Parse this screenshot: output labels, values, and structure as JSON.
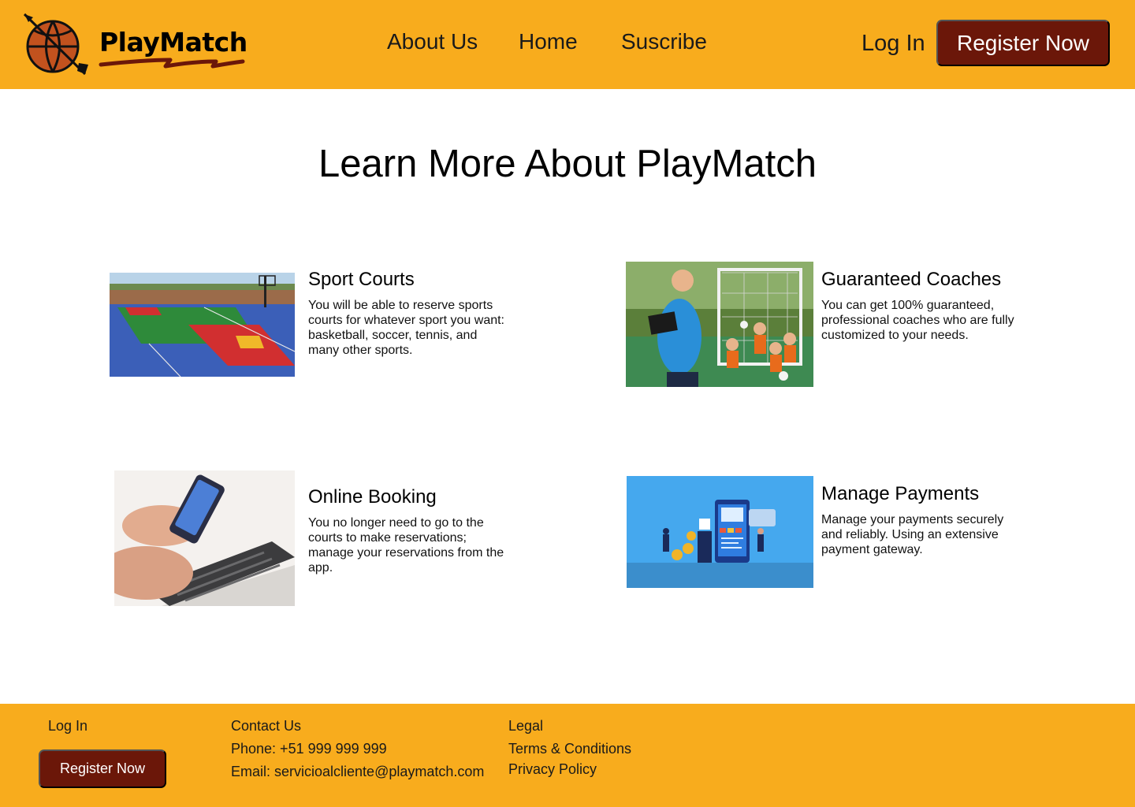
{
  "brand": {
    "name": "PlayMatch"
  },
  "nav": {
    "about": "About Us",
    "home": "Home",
    "subscribe": "Suscribe"
  },
  "header": {
    "login": "Log In",
    "register": "Register Now"
  },
  "main": {
    "title": "Learn More About PlayMatch",
    "features": [
      {
        "title": "Sport Courts",
        "description": "You will be able to reserve sports courts for whatever sport you want: basketball, soccer, tennis, and many other sports."
      },
      {
        "title": "Guaranteed Coaches",
        "description": "You can get 100% guaranteed, professional coaches who are fully customized to your needs."
      },
      {
        "title": "Online Booking",
        "description": "You no longer need to go to the courts to make reservations; manage your reservations from the app."
      },
      {
        "title": "Manage Payments",
        "description": "Manage your payments securely and reliably. Using an extensive payment gateway."
      }
    ]
  },
  "footer": {
    "login": "Log In",
    "register": "Register Now",
    "contact_heading": "Contact Us",
    "phone": "Phone: +51 999 999 999",
    "email": "Email: servicioalcliente@playmatch.com",
    "legal_heading": "Legal",
    "terms": "Terms & Conditions",
    "privacy": "Privacy Policy"
  },
  "colors": {
    "header_bg": "#F8AC1D",
    "button_bg": "#6B1709",
    "button_text": "#FFFFFF"
  }
}
